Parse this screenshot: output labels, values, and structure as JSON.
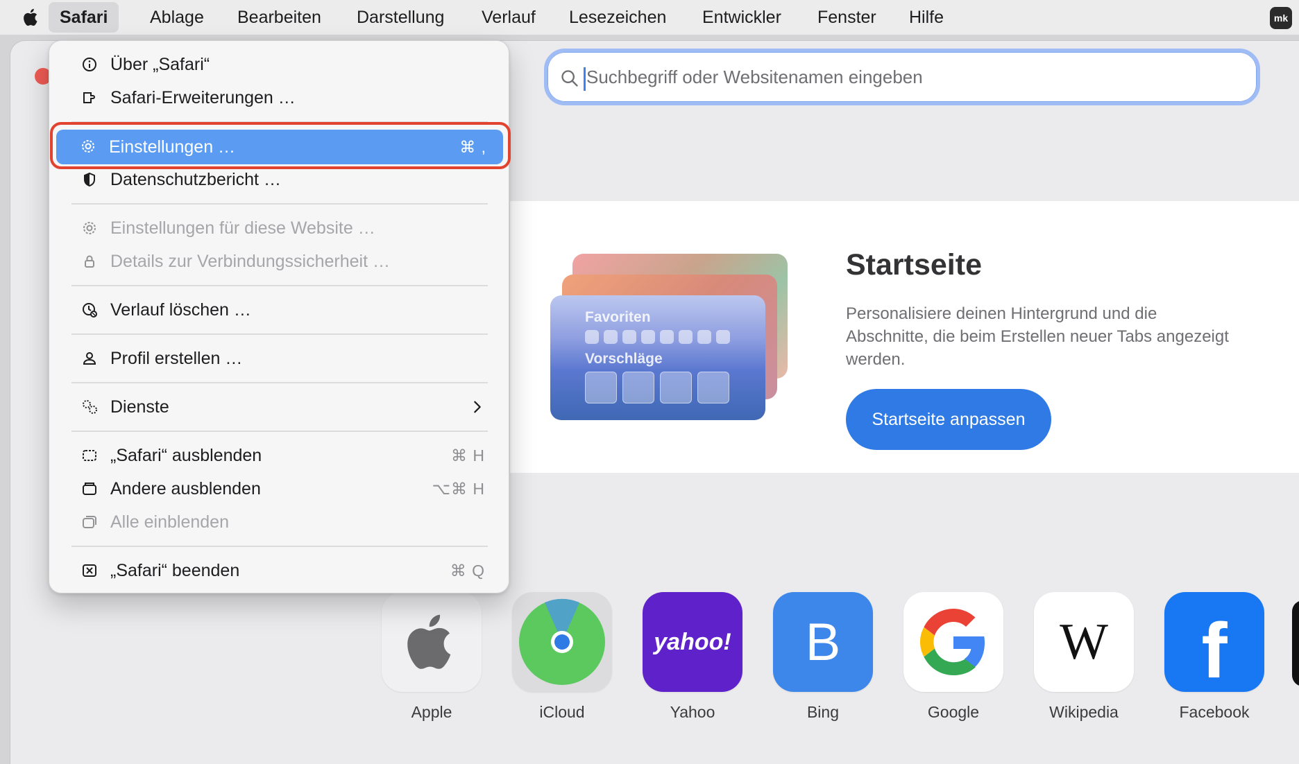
{
  "menubar": {
    "app": "Safari",
    "items": [
      "Ablage",
      "Bearbeiten",
      "Darstellung",
      "Verlauf",
      "Lesezeichen",
      "Entwickler",
      "Fenster",
      "Hilfe"
    ],
    "user_badge": "mk"
  },
  "search": {
    "placeholder": "Suchbegriff oder Websitenamen eingeben"
  },
  "safari_menu": {
    "items": [
      {
        "label": "Über „Safari“",
        "icon": "info-icon"
      },
      {
        "label": "Safari-Erweiterungen …",
        "icon": "extension-icon"
      },
      {
        "label": "Einstellungen …",
        "shortcut": "⌘ ,",
        "icon": "gear-icon",
        "highlighted": true
      },
      {
        "label": "Datenschutzbericht …",
        "icon": "shield-icon"
      },
      {
        "label": "Einstellungen für diese Website …",
        "icon": "gear-icon",
        "disabled": true
      },
      {
        "label": "Details zur Verbindungssicherheit …",
        "icon": "lock-icon",
        "disabled": true
      },
      {
        "label": "Verlauf löschen …",
        "icon": "clock-clear-icon"
      },
      {
        "label": "Profil erstellen …",
        "icon": "person-icon"
      },
      {
        "label": "Dienste",
        "icon": "services-icon",
        "submenu": true
      },
      {
        "label": "„Safari“ ausblenden",
        "shortcut": "⌘ H",
        "icon": "hide-icon"
      },
      {
        "label": "Andere ausblenden",
        "shortcut": "⌥⌘ H",
        "icon": "hide-others-icon"
      },
      {
        "label": "Alle einblenden",
        "icon": "show-all-icon",
        "disabled": true
      },
      {
        "label": "„Safari“ beenden",
        "shortcut": "⌘ Q",
        "icon": "quit-icon"
      }
    ]
  },
  "startpage_card": {
    "title": "Startseite",
    "description": "Personalisiere deinen Hintergrund und die Abschnitte, die beim Erstellen neuer Tabs angezeigt werden.",
    "button": "Startseite anpassen",
    "illustration_favorites": "Favoriten",
    "illustration_suggestions": "Vorschläge"
  },
  "favorites": [
    {
      "label": "Apple"
    },
    {
      "label": "iCloud"
    },
    {
      "label": "Yahoo",
      "logo_text": "yahoo!"
    },
    {
      "label": "Bing",
      "logo_text": "B"
    },
    {
      "label": "Google",
      "logo_text": "G"
    },
    {
      "label": "Wikipedia",
      "logo_text": "W"
    },
    {
      "label": "Facebook",
      "logo_text": "f"
    }
  ],
  "colors": {
    "highlight": "#5b9cf2",
    "accent": "#2f7ae5",
    "outline": "#e2432f"
  }
}
